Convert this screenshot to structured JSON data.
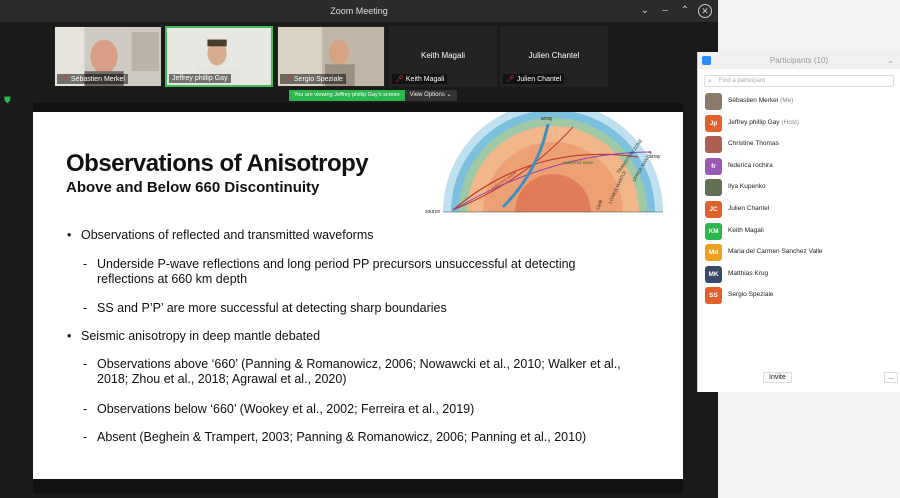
{
  "window": {
    "title": "Zoom Meeting"
  },
  "gallery": [
    {
      "name": "Sébastien Merkel",
      "video": true,
      "muted": true,
      "active": false
    },
    {
      "name": "Jeffrey phillip Gay",
      "video": true,
      "muted": false,
      "active": true
    },
    {
      "name": "Sergio Speziale",
      "video": true,
      "muted": true,
      "active": false
    },
    {
      "name": "Keith Magali",
      "video": false,
      "muted": true,
      "active": false
    },
    {
      "name": "Julien Chantel",
      "video": false,
      "muted": true,
      "active": false
    }
  ],
  "share": {
    "banner": "You are viewing Jeffrey phillip Gay's screen",
    "options": "View Options"
  },
  "slide": {
    "title": "Observations of Anisotropy",
    "subtitle": "Above and Below 660 Discontinuity",
    "bullets": [
      {
        "level": 1,
        "text": "Observations of reflected and transmitted waveforms"
      },
      {
        "level": 2,
        "text": "Underside P-wave reflections and long period PP precursors unsuccessful at detecting reflections at 660 km depth"
      },
      {
        "level": 2,
        "text": "SS and P’P’ are more successful at detecting sharp boundaries"
      },
      {
        "level": 1,
        "text": "Seismic anisotropy in deep mantle debated"
      },
      {
        "level": 2,
        "text": "Observations above ‘660’ (Panning & Romanowicz, 2006; Nowawcki et al., 2010; Walker et al., 2018; Zhou et al., 2018; Agrawal et al., 2020)"
      },
      {
        "level": 2,
        "text": "Observations below ‘660’ (Wookey et al., 2002; Ferreira et al., 2019)"
      },
      {
        "level": 2,
        "text": "Absent (Beghein & Trampert, 2003; Panning & Romanowicz, 2006; Panning et al., 2010)"
      }
    ],
    "diagram_labels": {
      "array_top": "array",
      "array_right": "array",
      "source": "source",
      "scattered": "scattered wave",
      "reflected": "reflected wave",
      "transition": "TRANSITION ZONE",
      "upper": "UPPER MANTLE",
      "lower": "LOWER MANTLE",
      "cmb": "CMB"
    }
  },
  "participants_panel": {
    "title": "Participants (10)",
    "search_placeholder": "Find a participant",
    "invite": "Invite",
    "more": "...",
    "list": [
      {
        "initials": "",
        "name": "Sébastien Merkel",
        "role": "(Me)",
        "color": "#8a7a6a",
        "photo": true
      },
      {
        "initials": "Jp",
        "name": "Jeffrey phillip Gay",
        "role": "(Host)",
        "color": "#e0622a",
        "photo": false
      },
      {
        "initials": "",
        "name": "Christine Thomas",
        "role": "",
        "color": "#b06050",
        "photo": true
      },
      {
        "initials": "fr",
        "name": "federica rochira",
        "role": "",
        "color": "#9b59b6",
        "photo": false
      },
      {
        "initials": "",
        "name": "Ilya Kupenko",
        "role": "",
        "color": "#607050",
        "photo": true
      },
      {
        "initials": "JC",
        "name": "Julien Chantel",
        "role": "",
        "color": "#e0622a",
        "photo": false
      },
      {
        "initials": "KM",
        "name": "Keith Magali",
        "role": "",
        "color": "#2db84d",
        "photo": false
      },
      {
        "initials": "Md",
        "name": "Maria del Carmen Sanchez Valle",
        "role": "",
        "color": "#f0a020",
        "photo": false
      },
      {
        "initials": "MK",
        "name": "Matthias Krug",
        "role": "",
        "color": "#3a4a6a",
        "photo": false
      },
      {
        "initials": "SS",
        "name": "Sergio Speziale",
        "role": "",
        "color": "#e0622a",
        "photo": false
      }
    ]
  }
}
